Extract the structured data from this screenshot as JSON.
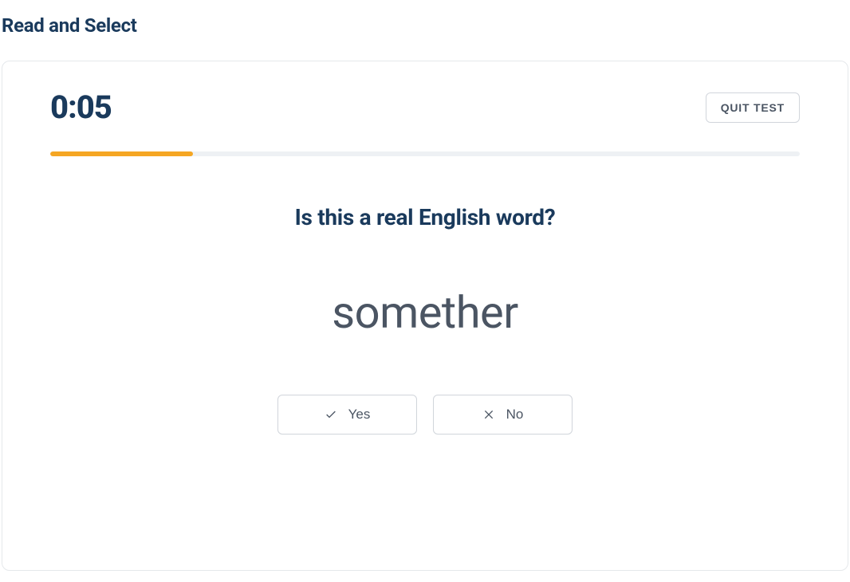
{
  "page": {
    "title": "Read and Select"
  },
  "timer": {
    "value": "0:05"
  },
  "quit": {
    "label": "QUIT TEST"
  },
  "progress": {
    "percent": 19
  },
  "question": {
    "prompt": "Is this a real English word?",
    "word": "somether"
  },
  "answers": {
    "yes_label": "Yes",
    "no_label": "No"
  },
  "colors": {
    "primary_text": "#1a3a5c",
    "secondary_text": "#4b5563",
    "progress_fill": "#f5a623",
    "progress_bg": "#eef1f4",
    "border": "#d1d5db"
  }
}
